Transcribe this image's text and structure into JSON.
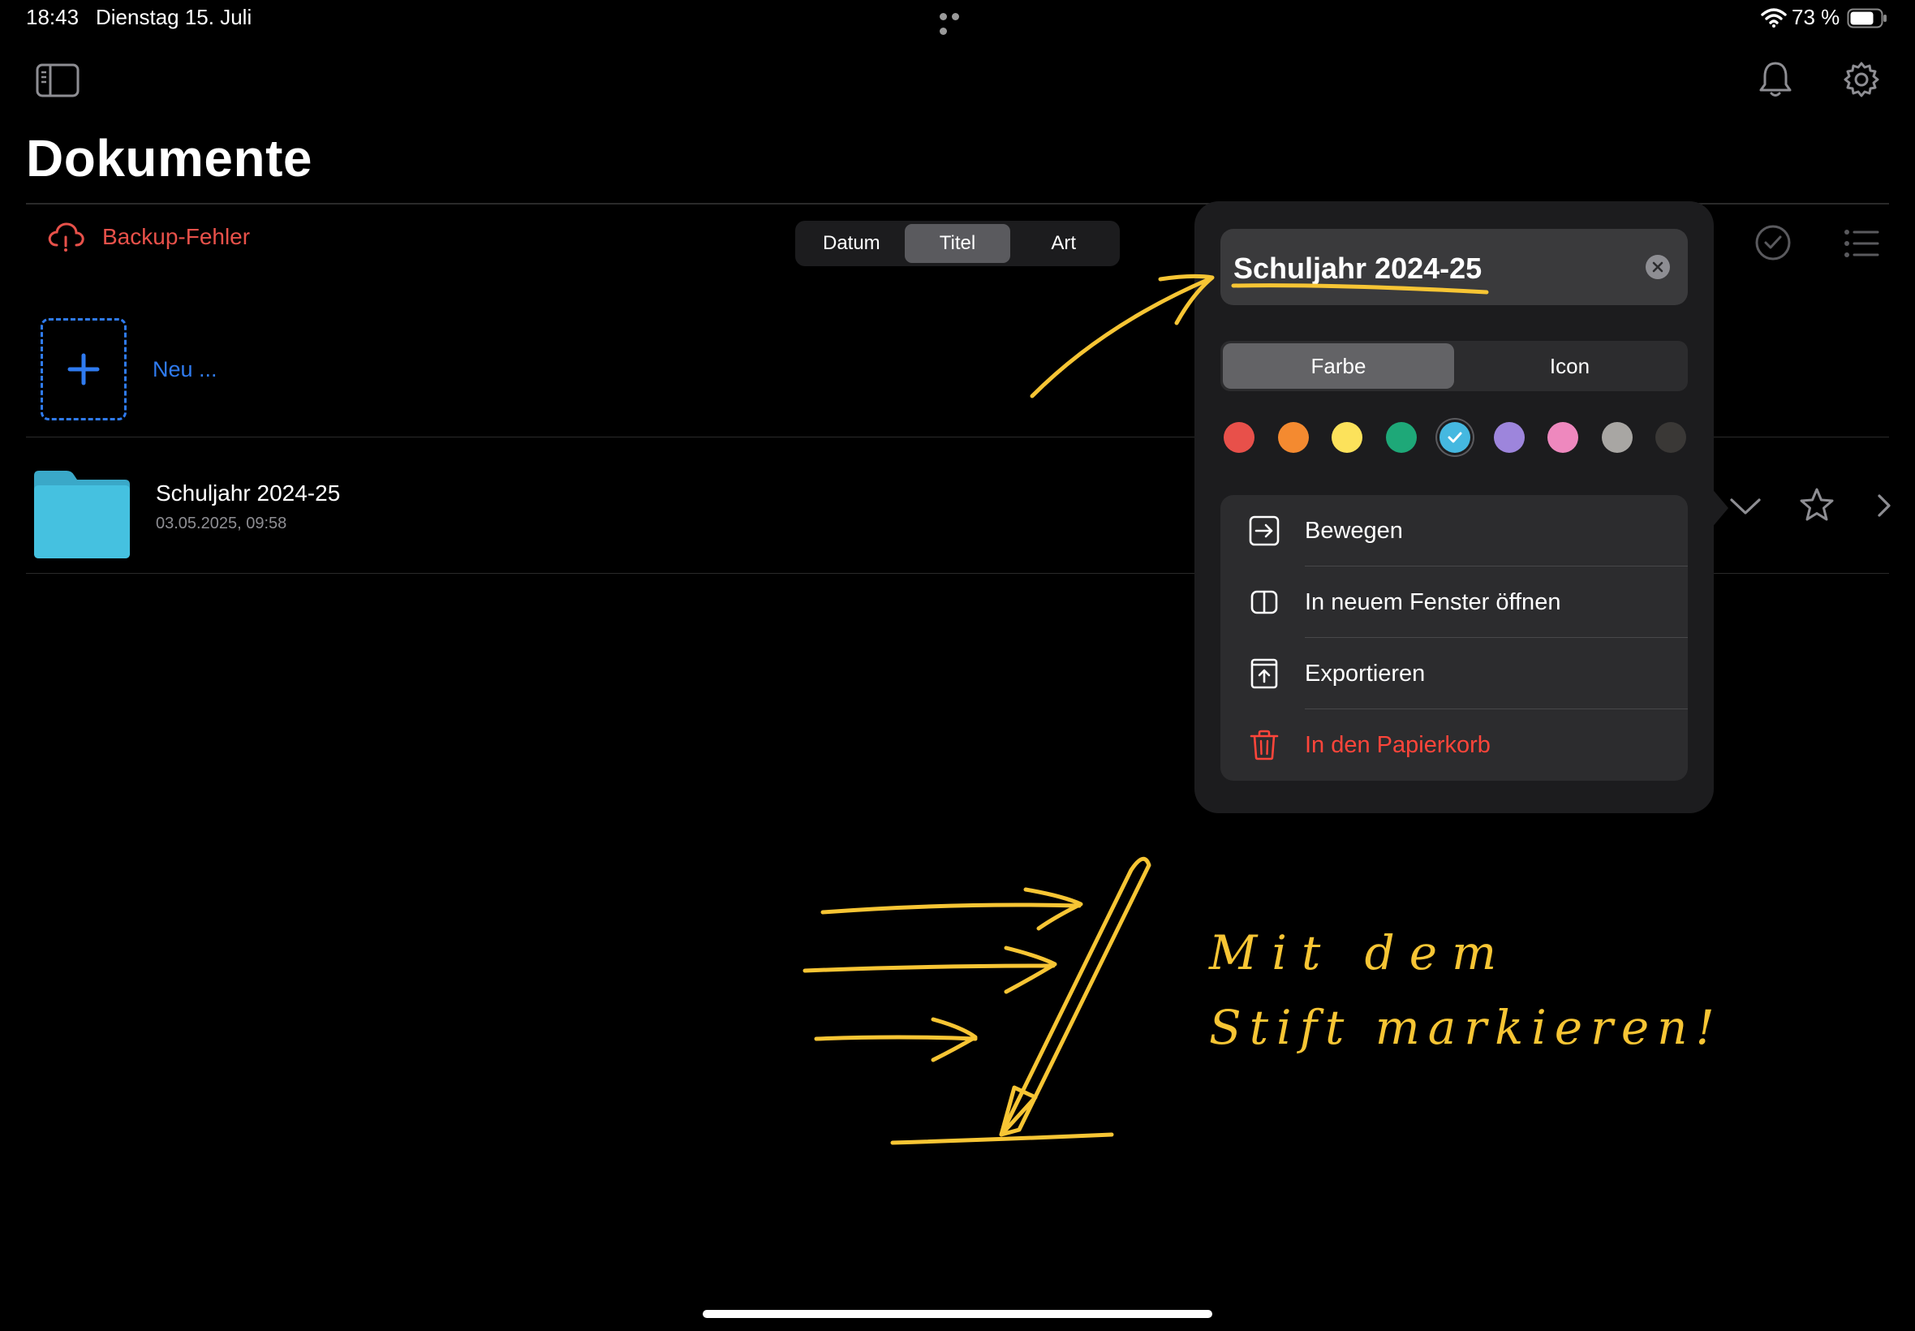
{
  "status": {
    "time": "18:43",
    "date": "Dienstag 15. Juli",
    "battery": "73 %"
  },
  "header": {
    "title": "Dokumente"
  },
  "backup": {
    "label": "Backup-Fehler"
  },
  "sort": {
    "tabs": [
      {
        "label": "Datum",
        "active": false
      },
      {
        "label": "Titel",
        "active": true
      },
      {
        "label": "Art",
        "active": false
      }
    ]
  },
  "new_item": {
    "label": "Neu ..."
  },
  "file": {
    "name": "Schuljahr 2024-25",
    "date": "03.05.2025, 09:58",
    "color": "#45c1e0"
  },
  "popover": {
    "name_value": "Schuljahr 2024-25",
    "tabs": [
      {
        "label": "Farbe",
        "active": true
      },
      {
        "label": "Icon",
        "active": false
      }
    ],
    "colors": [
      "#e8504a",
      "#f48a30",
      "#fce25b",
      "#1ea878",
      "#45b8e0",
      "#9d85dc",
      "#ee88be",
      "#a8a6a3",
      "#3a3836"
    ],
    "selected_color_index": 4,
    "menu": [
      {
        "label": "Bewegen",
        "icon": "move-icon",
        "danger": false
      },
      {
        "label": "In neuem Fenster öffnen",
        "icon": "split-window-icon",
        "danger": false
      },
      {
        "label": "Exportieren",
        "icon": "export-icon",
        "danger": false
      },
      {
        "label": "In den Papierkorb",
        "icon": "trash-icon",
        "danger": true
      }
    ]
  },
  "annotation": {
    "line1": "Mit dem",
    "line2": "Stift markieren!",
    "color": "#f7c534"
  },
  "colors": {
    "accent": "#2f7bf0",
    "error": "#e8514a"
  }
}
